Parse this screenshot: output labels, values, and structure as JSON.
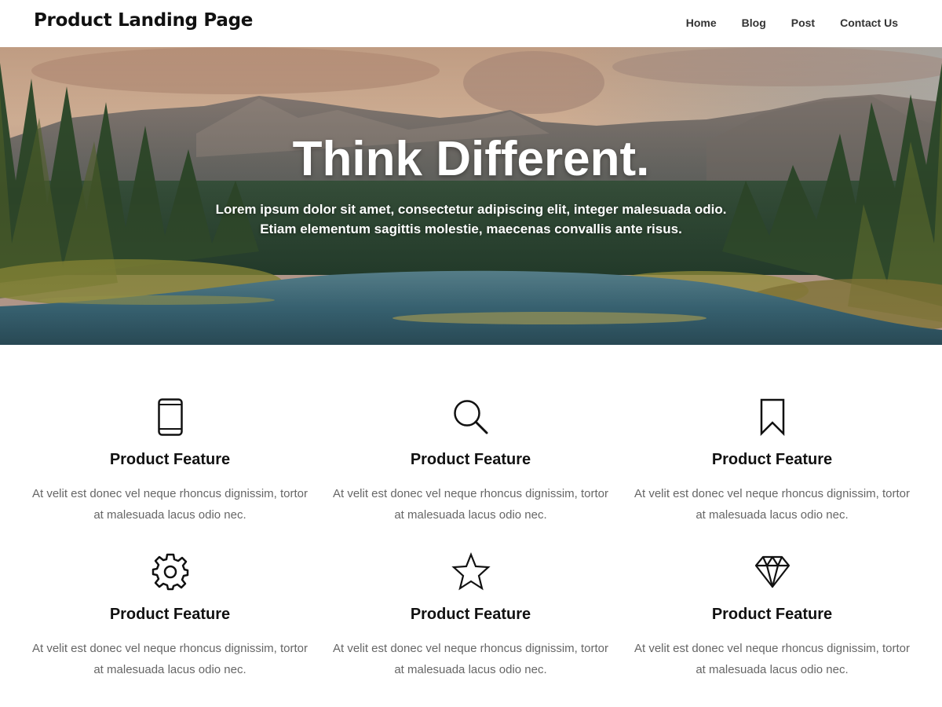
{
  "header": {
    "logo": "Product Landing Page",
    "nav": [
      "Home",
      "Blog",
      "Post",
      "Contact Us"
    ]
  },
  "hero": {
    "title": "Think Different.",
    "subtitle_line1": "Lorem ipsum dolor sit amet, consectetur adipiscing elit, integer malesuada odio.",
    "subtitle_line2": "Etiam elementum sagittis molestie, maecenas convallis ante risus."
  },
  "features": [
    {
      "icon": "tablet-icon",
      "title": "Product Feature",
      "line1": "At velit est donec vel neque rhoncus dignissim, tortor",
      "line2": "at malesuada lacus odio nec."
    },
    {
      "icon": "search-icon",
      "title": "Product Feature",
      "line1": "At velit est donec vel neque rhoncus dignissim, tortor",
      "line2": "at malesuada lacus odio nec."
    },
    {
      "icon": "bookmark-icon",
      "title": "Product Feature",
      "line1": "At velit est donec vel neque rhoncus dignissim, tortor",
      "line2": "at malesuada lacus odio nec."
    },
    {
      "icon": "gear-icon",
      "title": "Product Feature",
      "line1": "At velit est donec vel neque rhoncus dignissim, tortor",
      "line2": "at malesuada lacus odio nec."
    },
    {
      "icon": "star-icon",
      "title": "Product Feature",
      "line1": "At velit est donec vel neque rhoncus dignissim, tortor",
      "line2": "at malesuada lacus odio nec."
    },
    {
      "icon": "diamond-icon",
      "title": "Product Feature",
      "line1": "At velit est donec vel neque rhoncus dignissim, tortor",
      "line2": "at malesuada lacus odio nec."
    }
  ]
}
